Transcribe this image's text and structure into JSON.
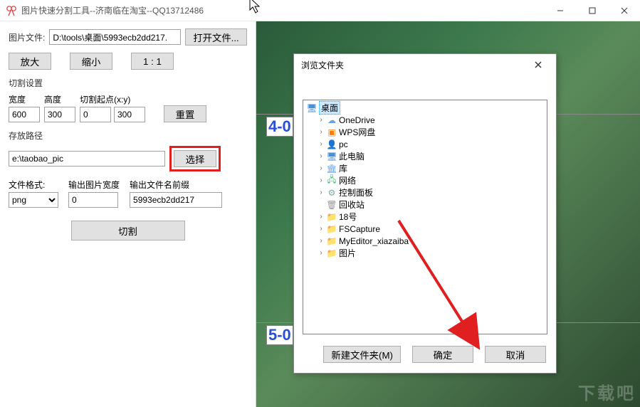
{
  "titlebar": {
    "title": "图片快速分割工具--济南临在淘宝--QQ13712486"
  },
  "left": {
    "file_label": "图片文件:",
    "file_path": "D:\\tools\\桌面\\5993ecb2dd217.",
    "open_file": "打开文件...",
    "zoom_in": "放大",
    "zoom_out": "缩小",
    "zoom_11": "1 : 1",
    "cut_settings": "切割设置",
    "width_label": "宽度",
    "height_label": "高度",
    "origin_label": "切割起点(x:y)",
    "width_val": "600",
    "height_val": "300",
    "ox_val": "0",
    "oy_val": "300",
    "reset": "重置",
    "save_path_label": "存放路径",
    "save_path": "e:\\taobao_pic",
    "choose": "选择",
    "fmt_label": "文件格式:",
    "fmt_val": "png",
    "out_w_label": "输出图片宽度",
    "out_w_val": "0",
    "prefix_label": "输出文件名前缀",
    "prefix_val": "5993ecb2dd217",
    "cut": "切割"
  },
  "right": {
    "label4": "4-0",
    "label5": "5-0"
  },
  "dialog": {
    "title": "浏览文件夹",
    "root": "桌面",
    "items": [
      {
        "icon": "cloud",
        "label": "OneDrive",
        "twisty": ">"
      },
      {
        "icon": "wps",
        "label": "WPS网盘",
        "twisty": ">"
      },
      {
        "icon": "pc",
        "label": "pc",
        "twisty": ">"
      },
      {
        "icon": "monitor",
        "label": "此电脑",
        "twisty": ">"
      },
      {
        "icon": "lib",
        "label": "库",
        "twisty": ">"
      },
      {
        "icon": "net",
        "label": "网络",
        "twisty": ">"
      },
      {
        "icon": "panel",
        "label": "控制面板",
        "twisty": ">"
      },
      {
        "icon": "trash",
        "label": "回收站",
        "twisty": ""
      },
      {
        "icon": "folder",
        "label": "18号",
        "twisty": ">"
      },
      {
        "icon": "folder",
        "label": "FSCapture",
        "twisty": ">"
      },
      {
        "icon": "folder",
        "label": "MyEditor_xiazaiba",
        "twisty": ">"
      },
      {
        "icon": "folder",
        "label": "图片",
        "twisty": ">"
      }
    ],
    "new_folder": "新建文件夹(M)",
    "ok": "确定",
    "cancel": "取消"
  },
  "watermark": "下载吧"
}
